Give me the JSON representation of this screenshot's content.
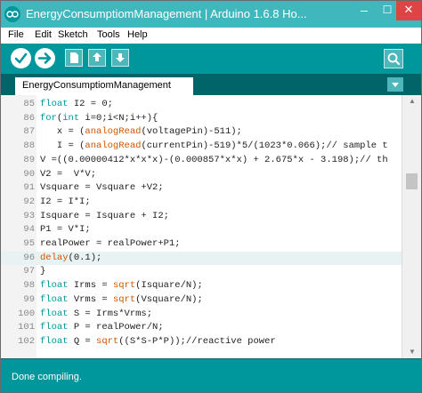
{
  "window": {
    "title": "EnergyConsumptiomManagement | Arduino 1.6.8 Ho..."
  },
  "menu": {
    "items": [
      "File",
      "Edit",
      "Sketch",
      "Tools",
      "Help"
    ]
  },
  "toolbar": {
    "buttons": [
      "verify-icon",
      "upload-icon",
      "new-icon",
      "open-icon",
      "save-icon",
      "serial-monitor-icon"
    ]
  },
  "tabs": [
    {
      "label": "EnergyConsumptiomManagement"
    }
  ],
  "editor": {
    "current_line": 96,
    "lines": [
      {
        "n": "85",
        "t": "float I2 = 0;"
      },
      {
        "n": "86",
        "t": "for(int i=0;i<N;i++){"
      },
      {
        "n": "87",
        "t": "   x = (analogRead(voltagePin)-511);"
      },
      {
        "n": "88",
        "t": "   I = (analogRead(currentPin)-519)*5/(1023*0.066);// sample t"
      },
      {
        "n": "89",
        "t": "V =((0.00000412*x*x*x)-(0.000857*x*x) + 2.675*x - 3.198);// th"
      },
      {
        "n": "90",
        "t": "V2 =  V*V;"
      },
      {
        "n": "91",
        "t": "Vsquare = Vsquare +V2;"
      },
      {
        "n": "92",
        "t": "I2 = I*I;"
      },
      {
        "n": "93",
        "t": "Isquare = Isquare + I2;"
      },
      {
        "n": "94",
        "t": "P1 = V*I;"
      },
      {
        "n": "95",
        "t": "realPower = realPower+P1;"
      },
      {
        "n": "96",
        "t": "delay(0.1);"
      },
      {
        "n": "97",
        "t": "}"
      },
      {
        "n": "98",
        "t": "float Irms = sqrt(Isquare/N);"
      },
      {
        "n": "99",
        "t": "float Vrms = sqrt(Vsquare/N);"
      },
      {
        "n": "100",
        "t": "float S = Irms*Vrms;"
      },
      {
        "n": "101",
        "t": "float P = realPower/N;"
      },
      {
        "n": "102",
        "t": "float Q = sqrt((S*S-P*P));//reactive power"
      }
    ]
  },
  "status": {
    "text": "Done compiling."
  },
  "colors": {
    "teal": "#00979c",
    "dark_teal": "#006468",
    "keyword": "#00979c",
    "function": "#d35400"
  }
}
